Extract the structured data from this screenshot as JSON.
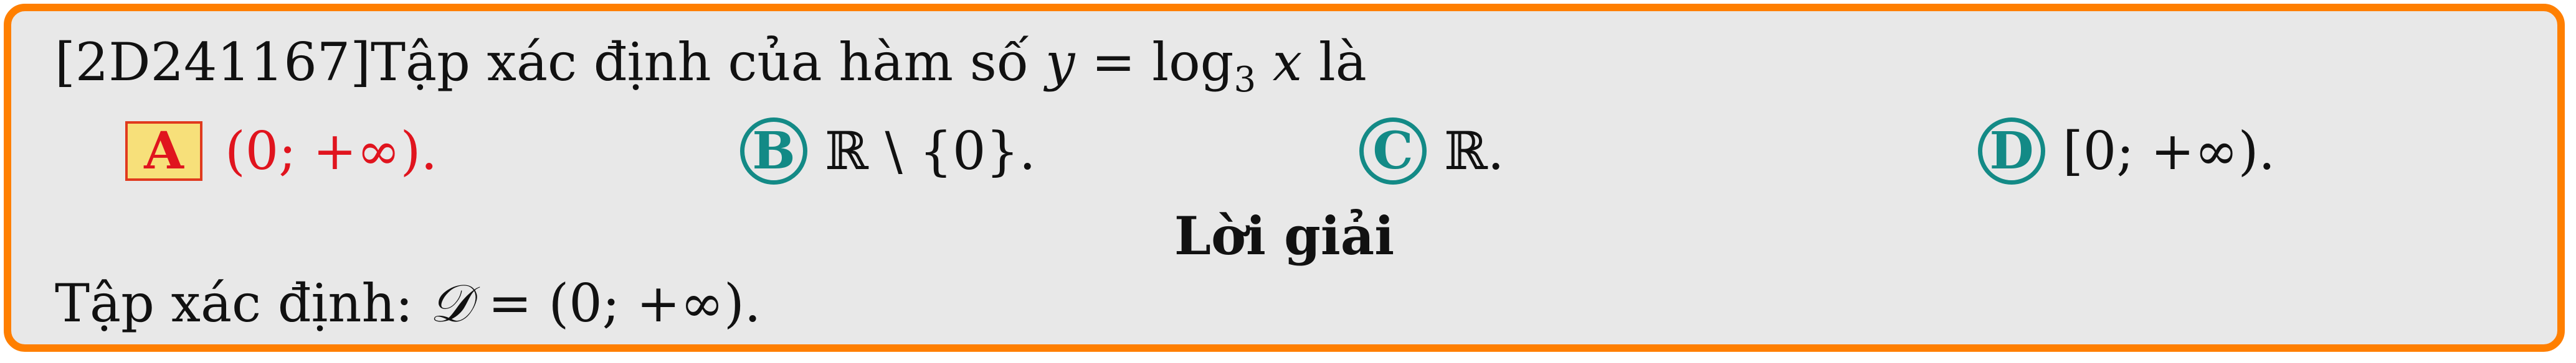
{
  "question": {
    "id": "[2D241167]",
    "text": "Tập xác định của hàm số ",
    "math_lhs": "y",
    "math_eq": " = log",
    "math_sub": "3",
    "math_var": " x",
    "suffix": " là"
  },
  "options": [
    {
      "letter": "A",
      "text": "(0; +∞).",
      "correct": true
    },
    {
      "letter": "B",
      "text": "ℝ \\ {0}.",
      "correct": false
    },
    {
      "letter": "C",
      "text": "ℝ.",
      "correct": false
    },
    {
      "letter": "D",
      "text": "[0; +∞).",
      "correct": false
    }
  ],
  "solution": {
    "heading": "Lời giải",
    "prefix": "Tập xác định: ",
    "symbol": "𝒟",
    "rest": " = (0; +∞)."
  },
  "colors": {
    "border": "#ff7f00",
    "card_background": "#e8e8e8",
    "correct": "#e0141e",
    "option_badge": "#138a86"
  }
}
